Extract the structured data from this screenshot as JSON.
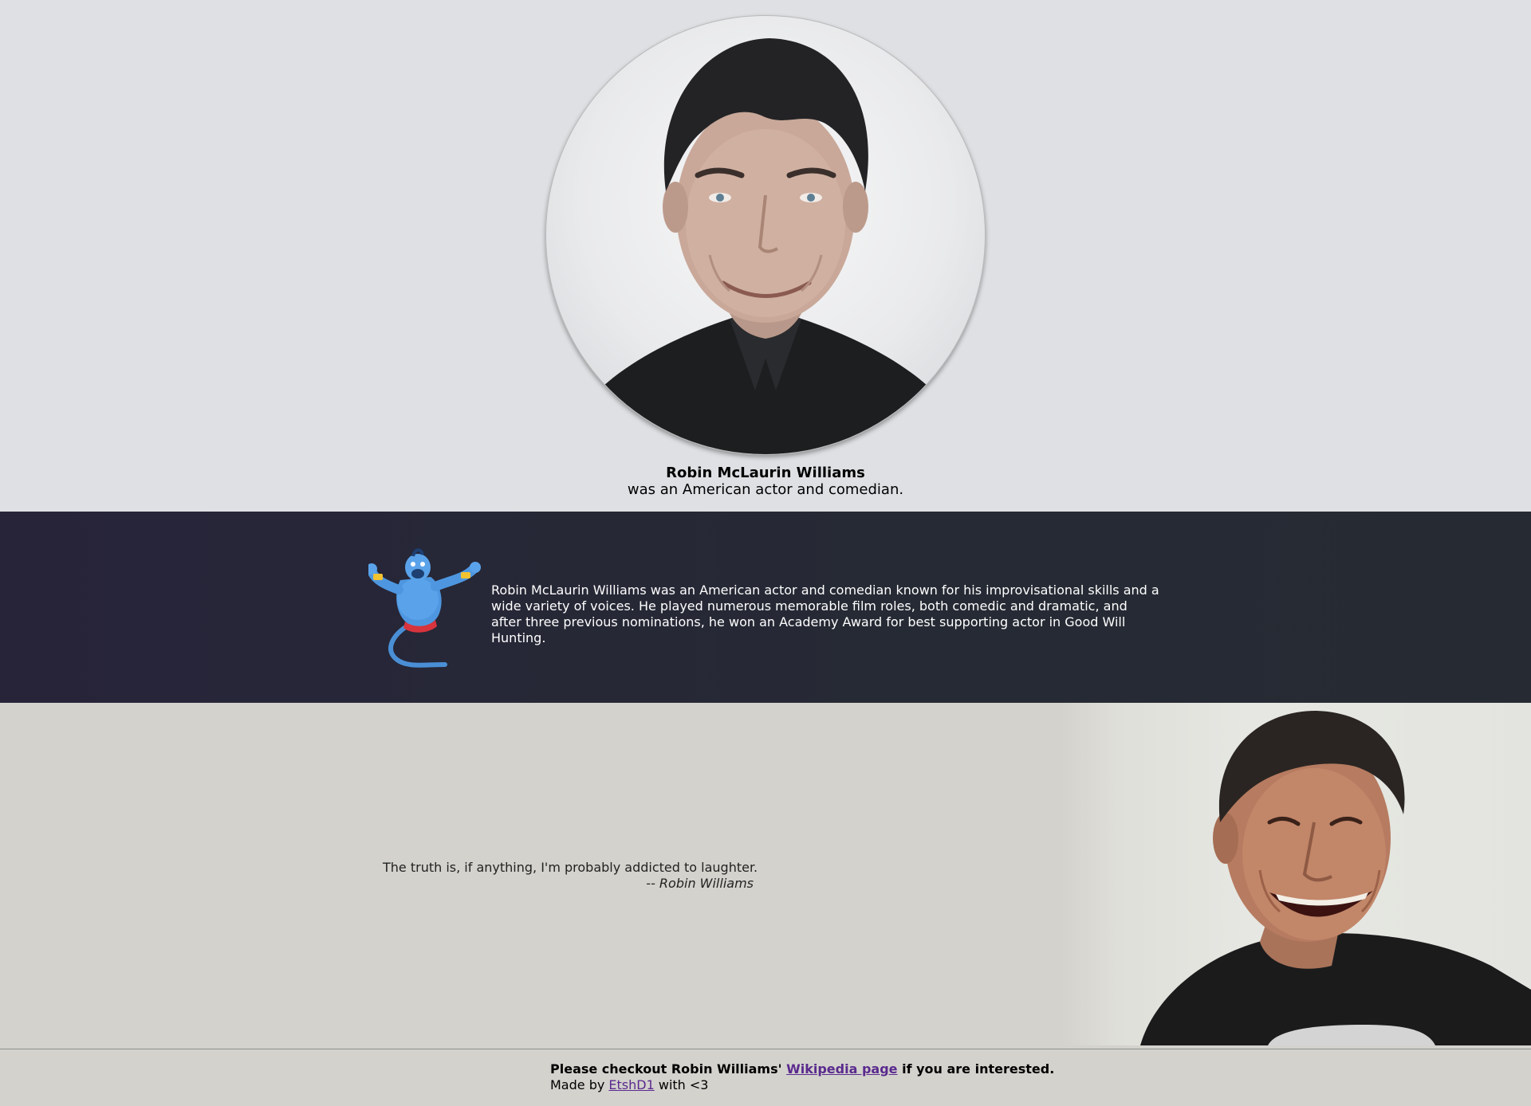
{
  "header": {
    "portrait_alt": "Robin Williams portrait",
    "name": "Robin McLaurin Williams",
    "description": "was an American actor and comedian."
  },
  "bio": {
    "text": "Robin McLaurin Williams was an American actor and comedian known for his improvisational skills and a wide variety of voices. He played numerous memorable film roles, both comedic and dramatic, and after three previous nominations, he won an Academy Award for best supporting actor in Good Will Hunting.",
    "icon": "genie-icon"
  },
  "quote": {
    "text": "The truth is, if anything, I'm probably addicted to laughter.",
    "author": "-- Robin Williams",
    "photo": "laughing-photo"
  },
  "footer": {
    "line1_prefix": "Please checkout Robin Williams' ",
    "link_label": "Wikipedia page",
    "line1_suffix": " if you are interested.",
    "made_by_prefix": "Made by ",
    "author_link": "EtshD1",
    "made_by_suffix": " with <3"
  },
  "colors": {
    "header_bg": "#dee0e3",
    "bio_bg": "#27243a",
    "quote_bg": "#d3d2cd",
    "link": "#5a2a8e"
  }
}
